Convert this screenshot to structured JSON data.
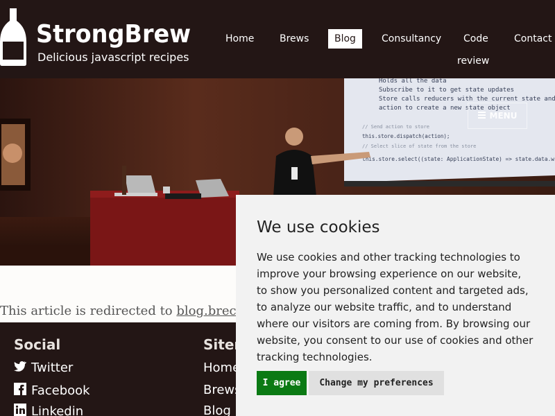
{
  "header": {
    "logo_title": "StrongBrew",
    "logo_tagline": "Delicious javascript recipes",
    "nav": {
      "home": "Home",
      "brews": "Brews",
      "blog": "Blog",
      "consultancy": "Consultancy",
      "code_line1": "Code",
      "code_line2": "review",
      "contact": "Contact"
    }
  },
  "hero": {
    "menu_label": "MENU",
    "slide_lines": [
      "Holds all the data",
      "Subscribe to it to get state updates",
      "Store calls reducers with the current state and an",
      "action to create a new state object",
      "// Send action to store",
      "this.store.dispatch(action);",
      "// Select slice of state from the store",
      "this.store.select((state: ApplicationState) => state.data.wines);"
    ]
  },
  "article": {
    "prefix": "This article is redirected to ",
    "link": "blog.brecht"
  },
  "footer": {
    "social_heading": "Social",
    "social_links": [
      "Twitter",
      "Facebook",
      "Linkedin"
    ],
    "sitemap_heading": "Siten",
    "sitemap_links": [
      "Home",
      "Brews",
      "Blog"
    ]
  },
  "cookie": {
    "title": "We use cookies",
    "body": "We use cookies and other tracking technologies to improve your browsing experience on our website, to show you personalized content and targeted ads, to analyze our website traffic, and to understand where our visitors are coming from. By browsing our website, you consent to our use of cookies and other tracking technologies.",
    "agree_label": "I agree",
    "prefs_label": "Change my preferences"
  },
  "colors": {
    "header_bg": "#231615",
    "agree_green": "#0b7a14",
    "cookie_bg": "#f2f2f2"
  }
}
